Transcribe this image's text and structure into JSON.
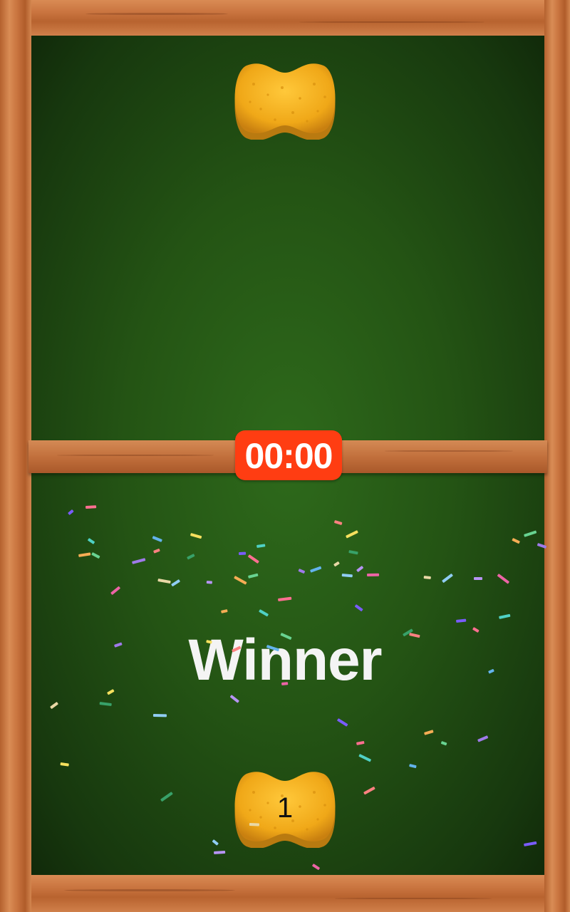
{
  "game": {
    "timer": "00:00",
    "result_text": "Winner",
    "player_score": "1"
  },
  "colors": {
    "board": "#245414",
    "frame": "#c9743f",
    "timer_bg": "#ff3d12",
    "sponge": "#f0b020"
  },
  "icons": {
    "top_paddle": "sponge-paddle-icon",
    "bottom_paddle": "sponge-paddle-icon"
  }
}
